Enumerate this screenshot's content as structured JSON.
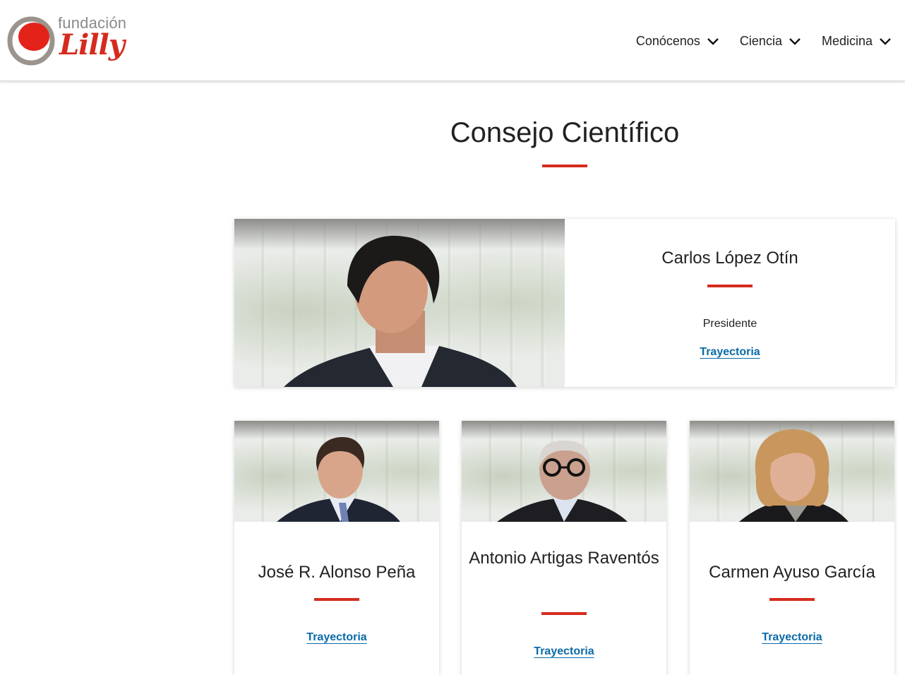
{
  "header": {
    "logo": {
      "top_word": "fundación",
      "script_word": "Lilly"
    },
    "nav": [
      {
        "label": "Conócenos"
      },
      {
        "label": "Ciencia"
      },
      {
        "label": "Medicina"
      }
    ]
  },
  "page_title": "Consejo Científico",
  "featured": {
    "name": "Carlos López Otín",
    "role": "Presidente",
    "link": "Trayectoria"
  },
  "members": [
    {
      "name": "José R. Alonso Peña",
      "link": "Trayectoria"
    },
    {
      "name": "Antonio Artigas Raventós",
      "link": "Trayectoria"
    },
    {
      "name": "Carmen Ayuso García",
      "link": "Trayectoria"
    }
  ],
  "colors": {
    "accent": "#d52b1e",
    "link": "#0a6aa8",
    "text": "#222222"
  }
}
